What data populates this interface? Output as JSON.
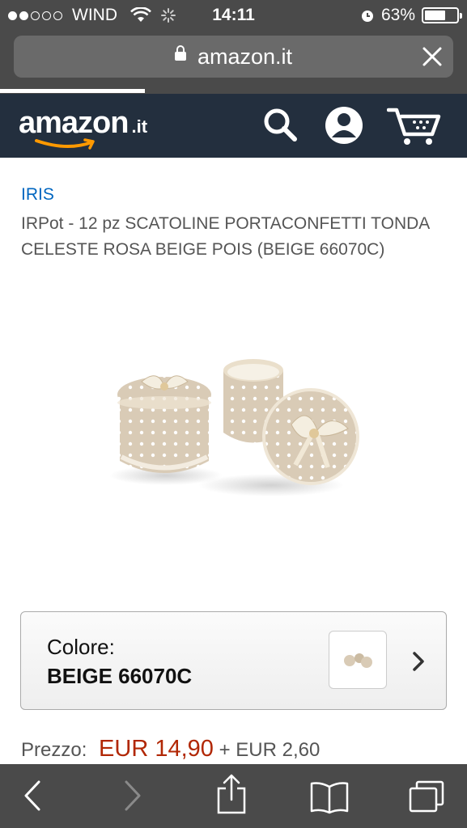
{
  "status_bar": {
    "carrier": "WIND",
    "time": "14:11",
    "battery": "63%",
    "signal_bars_filled": 2,
    "signal_bars_total": 5
  },
  "browser": {
    "url": "amazon.it",
    "load_progress": 0.31
  },
  "header": {
    "logo_word": "amazon",
    "logo_tld": ".it",
    "icons": [
      "search-icon",
      "account-icon",
      "cart-icon"
    ]
  },
  "product": {
    "brand": "IRIS",
    "title": "IRPot - 12 pz SCATOLINE PORTACONFETTI TONDA CELESTE ROSA BEIGE POIS (BEIGE 66070C)",
    "color_label": "Colore:",
    "color_value": "BEIGE 66070C",
    "price_label": "Prezzo:",
    "price": "EUR 14,90",
    "shipping": "+ EUR 2,60"
  },
  "toolbar": {
    "icons": [
      "back-icon",
      "forward-icon",
      "share-icon",
      "bookmarks-icon",
      "tabs-icon"
    ]
  },
  "colors": {
    "amazon_header": "#232f3e",
    "amazon_orange": "#ff9900",
    "link_blue": "#0066c0",
    "price_red": "#b12704",
    "safari_chrome": "#4a4a4a"
  }
}
